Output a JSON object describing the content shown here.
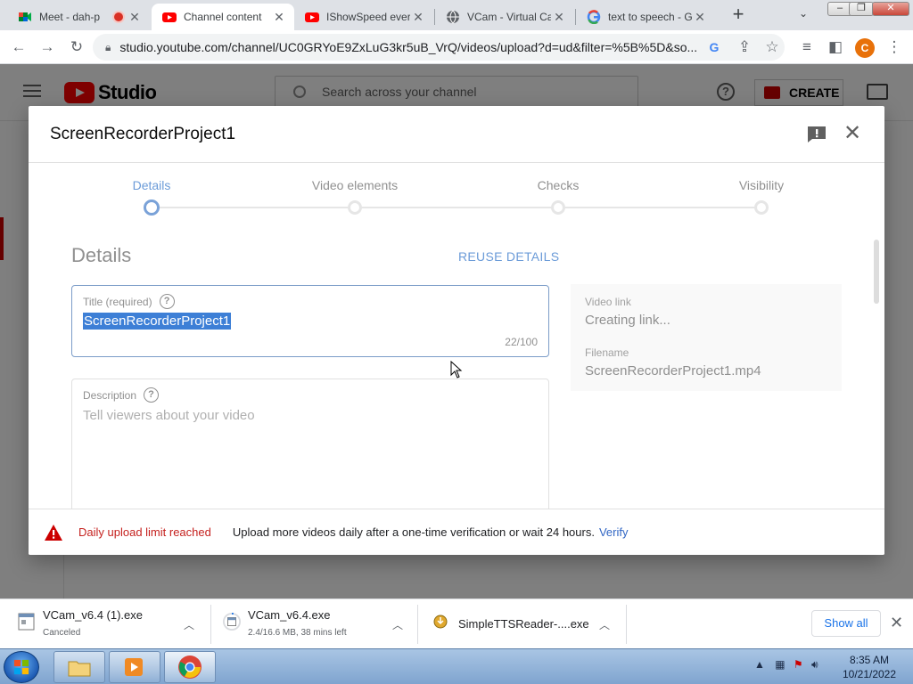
{
  "browser": {
    "tabs": [
      {
        "title": "Meet - dah-p",
        "favicon": "google-meet-icon"
      },
      {
        "title": "Channel content",
        "favicon": "youtube-icon"
      },
      {
        "title": "IShowSpeed ever",
        "favicon": "youtube-icon"
      },
      {
        "title": "VCam - Virtual Ca",
        "favicon": "globe-icon"
      },
      {
        "title": "text to speech - G",
        "favicon": "google-icon"
      }
    ],
    "active_tab": 1,
    "url": "studio.youtube.com/channel/UC0GRYoE9ZxLuG3kr5uB_VrQ/videos/upload?d=ud&filter=%5B%5D&so...",
    "profile_initial": "C",
    "profile_color": "#e8710a"
  },
  "studio": {
    "logo_text": "Studio",
    "search_placeholder": "Search across your channel",
    "create_label": "CREATE",
    "brand_red": "#ff0000"
  },
  "modal": {
    "title": "ScreenRecorderProject1",
    "steps": [
      "Details",
      "Video elements",
      "Checks",
      "Visibility"
    ],
    "active_step": 0,
    "section_heading": "Details",
    "reuse_label": "REUSE DETAILS",
    "title_field": {
      "label": "Title (required)",
      "value": "ScreenRecorderProject1",
      "counter": "22/100"
    },
    "description_field": {
      "label": "Description",
      "placeholder": "Tell viewers about your video"
    },
    "side_card": {
      "video_link_label": "Video link",
      "video_link_value": "Creating link...",
      "filename_label": "Filename",
      "filename_value": "ScreenRecorderProject1.mp4"
    },
    "footer": {
      "limit_text": "Daily upload limit reached",
      "message": "Upload more videos daily after a one-time verification or wait 24 hours.",
      "verify_label": "Verify"
    }
  },
  "downloads": {
    "items": [
      {
        "name": "VCam_v6.4 (1).exe",
        "status": "Canceled"
      },
      {
        "name": "VCam_v6.4.exe",
        "status": "2.4/16.6 MB, 38 mins left"
      },
      {
        "name": "SimpleTTSReader-....exe",
        "status": ""
      }
    ],
    "show_all_label": "Show all"
  },
  "taskbar": {
    "time": "8:35 AM",
    "date": "10/21/2022"
  }
}
